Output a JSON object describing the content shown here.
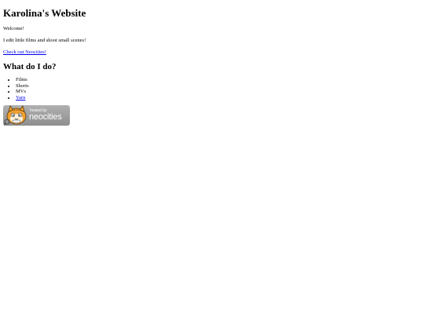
{
  "page": {
    "title": "Karolina's Website",
    "welcome": "Welcome!",
    "intro": "I edit little films and shoot small scenes!",
    "neocities_link": "Check out Neocities!",
    "section_heading": "What do I do?",
    "list_items": [
      "Films",
      "Shorts",
      "MVs"
    ],
    "list_link": "Yarn"
  },
  "badge": {
    "small_text": "hosted by",
    "large_text": "neocities",
    "colors": {
      "background": "#9e9e9e",
      "cat_orange": "#f0a030",
      "text": "#ffffff"
    }
  },
  "colors": {
    "link": "#0000ee",
    "text": "#000000",
    "background": "#ffffff"
  }
}
